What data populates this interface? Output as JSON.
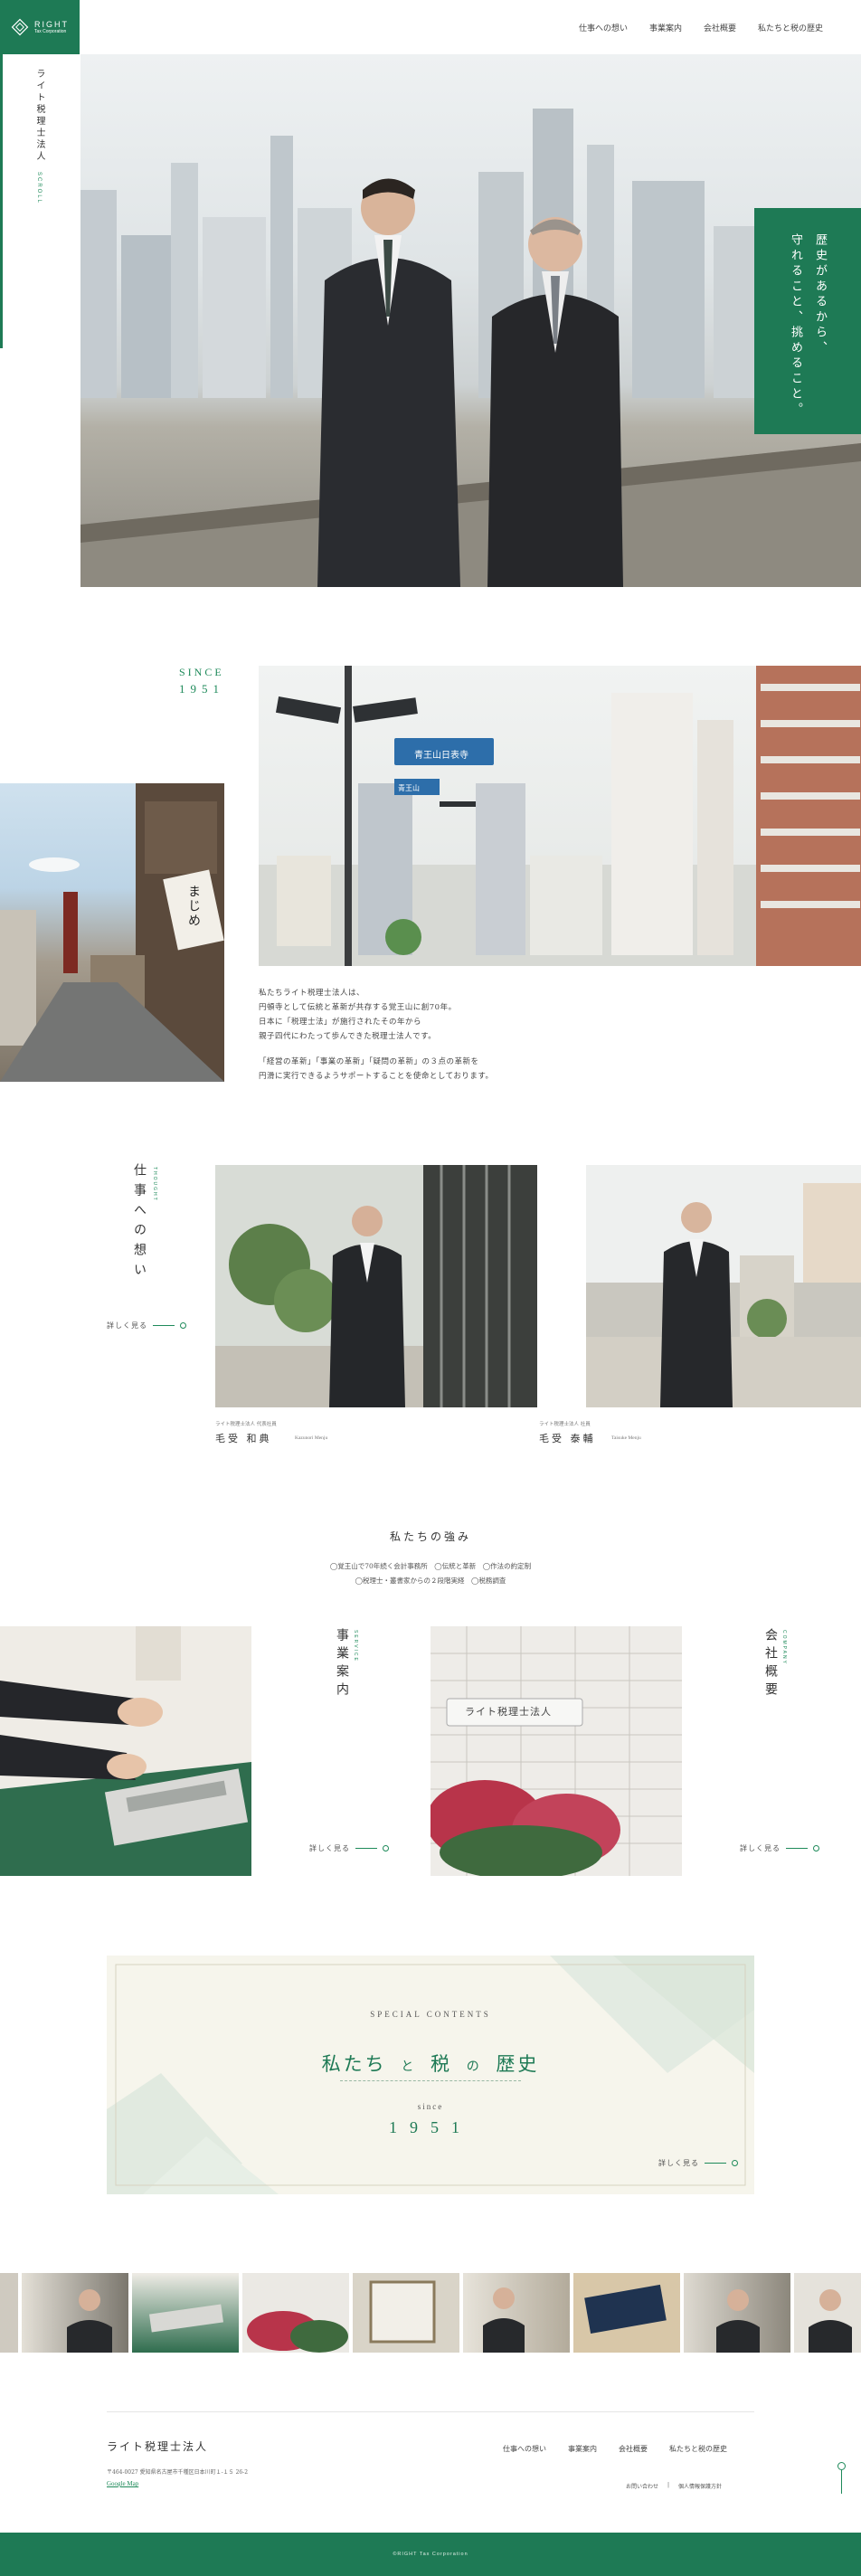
{
  "brand": {
    "logo_name": "RIGHT",
    "logo_sub": "Tax Corporation",
    "vertical_name": "ライト税理士法人",
    "scroll_label": "SCROLL"
  },
  "nav": {
    "items": [
      "仕事への想い",
      "事業案内",
      "会社概要",
      "私たちと税の歴史"
    ]
  },
  "hero": {
    "copy_line1": "歴史があるから、",
    "copy_line2": "守れること、挑めること。"
  },
  "since": {
    "label": "SINCE",
    "year": "1951"
  },
  "signs": {
    "sign1": "青王山日表寺",
    "sign2": "青王山"
  },
  "street_banner": "まじめ",
  "intro": {
    "p1_line1": "私たちライト税理士法人は、",
    "p1_line2": "円頓寺として伝統と革新が共存する覚王山に創70年。",
    "p1_line3": "日本に「税理士法」が施行されたその年から",
    "p1_line4": "親子四代にわたって歩んできた税理士法人です。",
    "p2_line1": "「経営の革新」「事業の革新」「疑問の革新」の３点の革新を",
    "p2_line2": "円滑に実行できるようサポートすることを使命としております。"
  },
  "thoughts": {
    "sub_en": "THOUGHT",
    "title": "仕事への想い",
    "more": "詳しく見る",
    "person1": {
      "role": "ライト税理士法人 代表社員",
      "name": "毛受 和典",
      "name_en": "Kazunori Menju"
    },
    "person2": {
      "role": "ライト税理士法人 社員",
      "name": "毛受 泰輔",
      "name_en": "Taisuke Menju"
    }
  },
  "strengths": {
    "title": "私たちの強み",
    "line1": "◯覚王山で70年続く会計事務所　◯伝統と革新　◯作法の約定制",
    "line2": "◯税理士・叢書家からの２段階実経　◯税務調査"
  },
  "business": {
    "sub_en": "SERVICE",
    "title": "事業案内",
    "more": "詳しく見る"
  },
  "plate": "ライト税理士法人",
  "company": {
    "sub_en": "COMPANY",
    "title": "会社概要",
    "more": "詳しく見る"
  },
  "special": {
    "label": "SPECIAL CONTENTS",
    "title_part1": "私たち",
    "title_conj": "と",
    "title_part2": "税",
    "title_conj2": "の",
    "title_part3": "歴史",
    "since": "since",
    "year": "1951",
    "more": "詳しく見る"
  },
  "footer": {
    "company": "ライト税理士法人",
    "address": "〒464-0027 愛知県名古屋市千種区日本川町１-１５ 26-2",
    "map_link": "Google Map",
    "nav": [
      "仕事への想い",
      "事業案内",
      "会社概要",
      "私たちと税の歴史"
    ],
    "links": [
      "お問い合わせ",
      "個人情報保護方針"
    ],
    "copyright": "©RIGHT Tax Corporation"
  },
  "colors": {
    "accent": "#1e7a55",
    "bg_cream": "#f6f5ec"
  }
}
